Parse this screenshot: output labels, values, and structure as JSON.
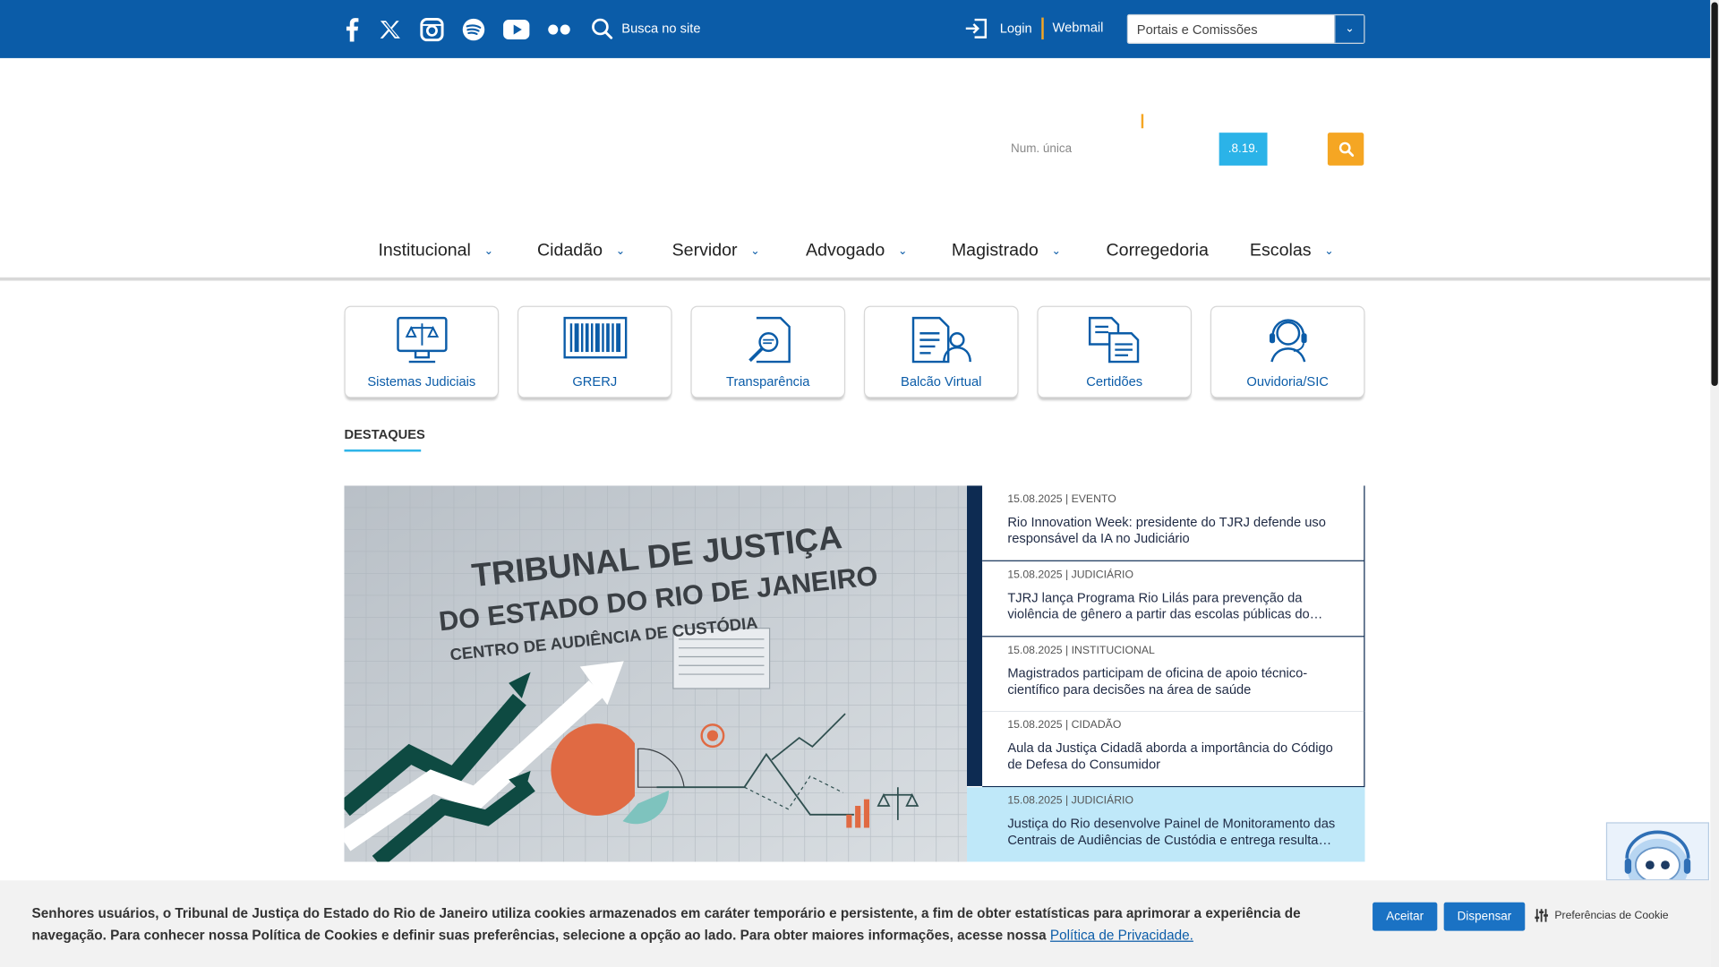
{
  "topbar": {
    "search_label": "Busca no site",
    "login_label": "Login",
    "webmail_label": "Webmail",
    "portais_value": "Portais e Comissões"
  },
  "process_search": {
    "placeholder": "Num. única",
    "code": ".8.19."
  },
  "nav": {
    "items": [
      {
        "label": "Institucional",
        "has_dropdown": true
      },
      {
        "label": "Cidadão",
        "has_dropdown": true
      },
      {
        "label": "Servidor",
        "has_dropdown": true
      },
      {
        "label": "Advogado",
        "has_dropdown": true
      },
      {
        "label": "Magistrado",
        "has_dropdown": true
      },
      {
        "label": "Corregedoria",
        "has_dropdown": false
      },
      {
        "label": "Escolas",
        "has_dropdown": true
      }
    ]
  },
  "quick_links": [
    {
      "label": "Sistemas Judiciais",
      "icon": "monitor-scales-icon"
    },
    {
      "label": "GRERJ",
      "icon": "barcode-icon"
    },
    {
      "label": "Transparência",
      "icon": "document-magnifier-icon"
    },
    {
      "label": "Balcão Virtual",
      "icon": "documents-person-icon"
    },
    {
      "label": "Certidões",
      "icon": "documents-stack-icon"
    },
    {
      "label": "Ouvidoria/SIC",
      "icon": "headset-icon"
    }
  ],
  "destaques": {
    "title": "DESTAQUES",
    "hero_sign": {
      "line1": "TRIBUNAL DE JUSTIÇA",
      "line2": "DO ESTADO DO RIO DE JANEIRO",
      "line3": "CENTRO DE AUDIÊNCIA DE CUSTÓDIA"
    },
    "news": [
      {
        "meta": "15.08.2025 | EVENTO",
        "title": "Rio Innovation Week: presidente do TJRJ defende uso responsável da IA no Judiciário"
      },
      {
        "meta": "15.08.2025 | JUDICIÁRIO",
        "title": "TJRJ lança Programa Rio Lilás para prevenção da violência de gênero a partir das escolas públicas do…"
      },
      {
        "meta": "15.08.2025 | INSTITUCIONAL",
        "title": "Magistrados participam de oficina de apoio técnico-científico para decisões na área de saúde"
      },
      {
        "meta": "15.08.2025 | CIDADÃO",
        "title": "Aula da Justiça Cidadã aborda a importância do Código de Defesa do Consumidor"
      },
      {
        "meta": "15.08.2025 | JUDICIÁRIO",
        "title": "Justiça do Rio desenvolve Painel de Monitoramento das Centrais de Audiências de Custódia e entrega resulta…",
        "active": true
      }
    ]
  },
  "cookie": {
    "text": "Senhores usuários, o Tribunal de Justiça do Estado do Rio de Janeiro utiliza cookies armazenados em caráter temporário e persistente, a fim de obter estatísticas para aprimorar a experiência de navegação. Para conhecer nossa Política de Cookies e definir suas preferências, selecione a opção ao lado. Para obter maiores informações, acesse nossa",
    "link": "Política de Privacidade.",
    "accept": "Aceitar",
    "dismiss": "Dispensar",
    "prefs": "Preferências de Cookie"
  },
  "colors": {
    "primary": "#0b5ca8",
    "accent": "#f5a623",
    "cyan": "#2bb3e8",
    "navy": "#0d2b52"
  }
}
